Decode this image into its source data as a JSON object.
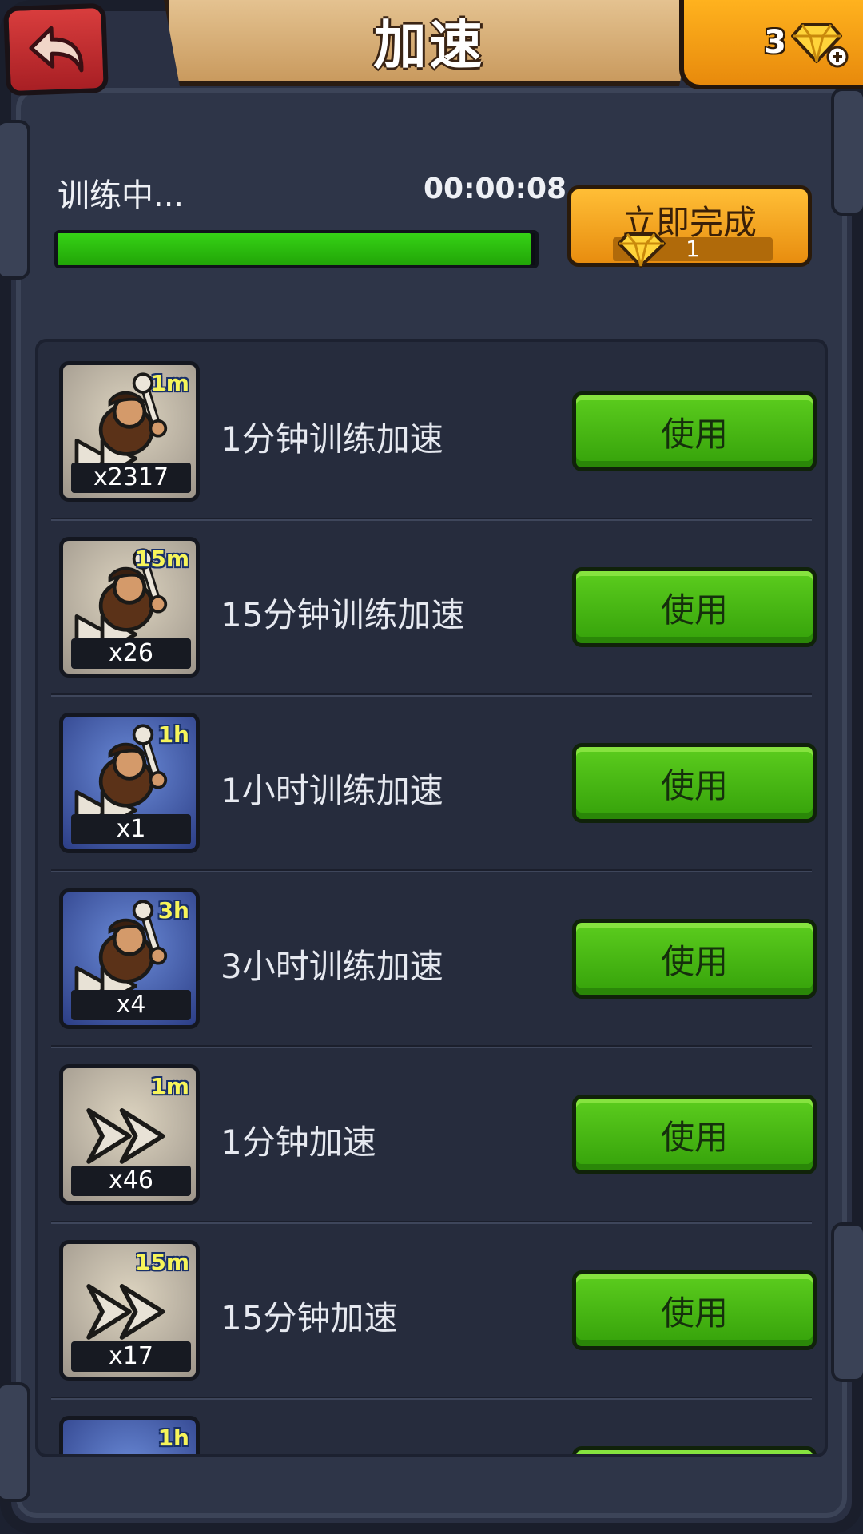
{
  "header": {
    "title": "加速",
    "gem_count": "3"
  },
  "status": {
    "label": "训练中...",
    "time_left": "00:00:08",
    "progress": 0.99
  },
  "finish_now": {
    "label": "立即完成",
    "cost": "1"
  },
  "items": [
    {
      "name": "1分钟训练加速",
      "badge": "1m",
      "count": "x2317",
      "tile": "tan",
      "art": "club",
      "button": "使用"
    },
    {
      "name": "15分钟训练加速",
      "badge": "15m",
      "count": "x26",
      "tile": "tan",
      "art": "club",
      "button": "使用"
    },
    {
      "name": "1小时训练加速",
      "badge": "1h",
      "count": "x1",
      "tile": "blue",
      "art": "club",
      "button": "使用"
    },
    {
      "name": "3小时训练加速",
      "badge": "3h",
      "count": "x4",
      "tile": "blue",
      "art": "club",
      "button": "使用"
    },
    {
      "name": "1分钟加速",
      "badge": "1m",
      "count": "x46",
      "tile": "tan",
      "art": "arrows",
      "button": "使用"
    },
    {
      "name": "15分钟加速",
      "badge": "15m",
      "count": "x17",
      "tile": "tan",
      "art": "arrows",
      "button": "使用"
    },
    {
      "name": "",
      "badge": "1h",
      "count": "",
      "tile": "blue",
      "art": "arrows",
      "button": ""
    }
  ],
  "colors": {
    "use_button": "#35a10a",
    "finish_button": "#e88d0f",
    "progress": "#21a507",
    "back_button": "#a81f24"
  }
}
